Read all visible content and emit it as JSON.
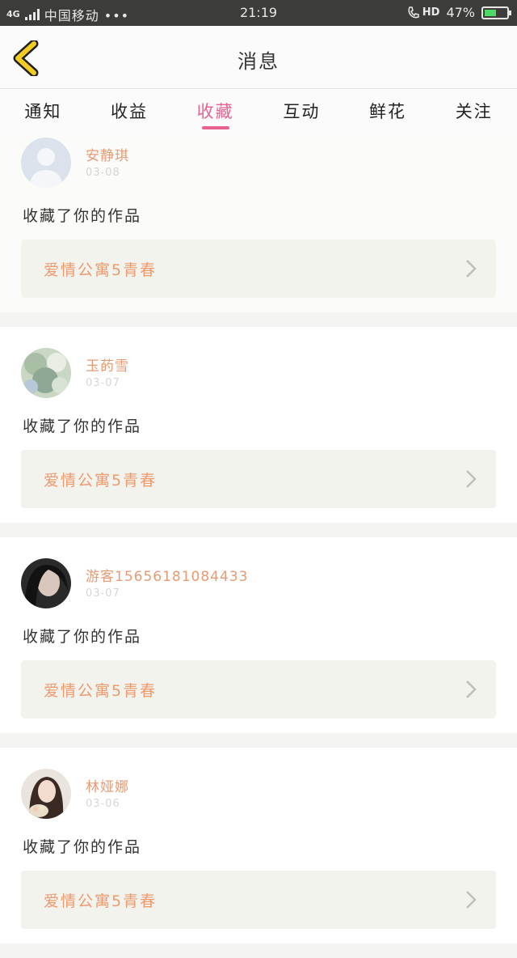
{
  "status_bar": {
    "network": "4G",
    "carrier": "中国移动 •••",
    "time": "21:19",
    "hd": "HD",
    "battery_percent": "47%",
    "battery_level": 0.47
  },
  "header": {
    "title": "消息",
    "back_icon": "chevron-left-icon",
    "accent_color": "#f2cc21"
  },
  "tabs": [
    {
      "label": "通知",
      "active": false
    },
    {
      "label": "收益",
      "active": false
    },
    {
      "label": "收藏",
      "active": true
    },
    {
      "label": "互动",
      "active": false
    },
    {
      "label": "鲜花",
      "active": false
    },
    {
      "label": "关注",
      "active": false
    }
  ],
  "tab_active_color": "#e8628f",
  "messages": [
    {
      "name": "安静琪",
      "date": "03-08",
      "action": "收藏了你的作品",
      "work": "爱情公寓5青春"
    },
    {
      "name": "玉菂雪",
      "date": "03-07",
      "action": "收藏了你的作品",
      "work": "爱情公寓5青春"
    },
    {
      "name": "游客15656181084433",
      "date": "03-07",
      "action": "收藏了你的作品",
      "work": "爱情公寓5青春"
    },
    {
      "name": "林娅娜",
      "date": "03-06",
      "action": "收藏了你的作品",
      "work": "爱情公寓5青春"
    }
  ]
}
